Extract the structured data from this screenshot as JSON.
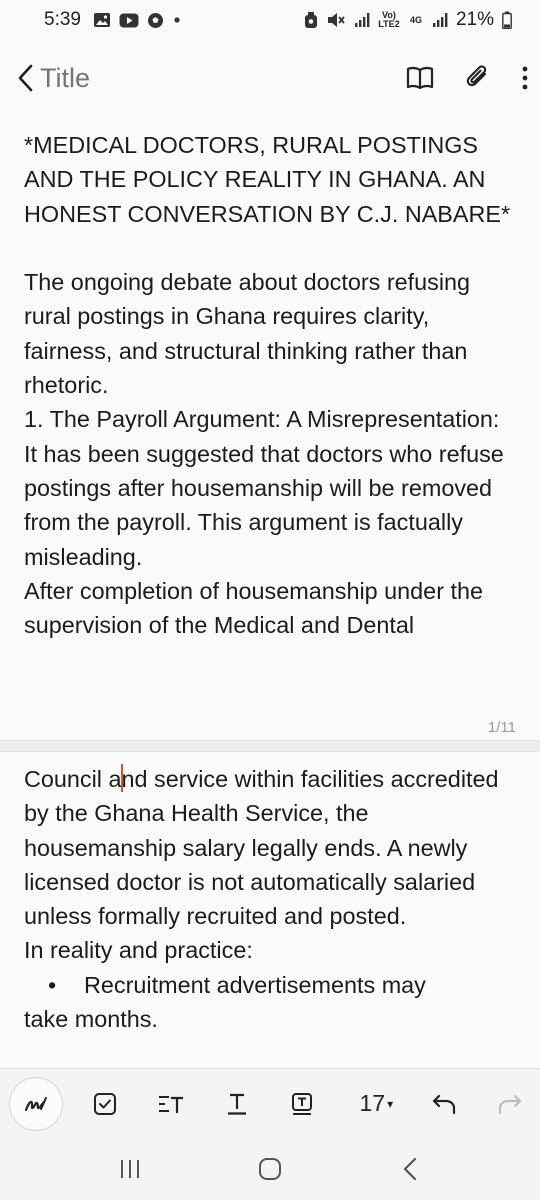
{
  "status_bar": {
    "time": "5:39",
    "left_icons": [
      "gallery-icon",
      "youtube-icon",
      "football-icon",
      "notification-dot-icon"
    ],
    "right_icons": [
      "alarm-icon",
      "mute-icon",
      "signal-icon",
      "volte-icon",
      "4g-icon",
      "signal-icon"
    ],
    "volte_label": "Vo) LTE2",
    "net_label": "4G",
    "battery": "21%"
  },
  "app_bar": {
    "title_placeholder": "Title",
    "actions": [
      "book-icon",
      "attach-icon",
      "more-icon"
    ]
  },
  "page1": {
    "heading": "*MEDICAL DOCTORS, RURAL POSTINGS AND THE POLICY REALITY IN GHANA. AN HONEST CONVERSATION BY C.J. NABARE*",
    "para1": "The ongoing debate about doctors refusing rural postings in Ghana requires clarity, fairness, and structural thinking rather than rhetoric.",
    "section1_title": "1. The Payroll Argument: A Misrepresentation:",
    "para2": "It has been suggested that doctors who refuse postings after housemanship will be removed from the payroll. This argument is factually misleading.",
    "para3": "After completion of housemanship under the supervision of the Medical and Dental",
    "page_number": "1/11"
  },
  "page2": {
    "para1_before_cursor": "Council a",
    "para1_after_cursor": "nd service within facilities accredited by the Ghana Health Service, the housemanship salary legally ends. A newly licensed doctor is not automatically salaried unless formally recruited and posted.",
    "para2": "In reality and practice:",
    "bullet1_line1": "Recruitment advertisements may",
    "bullet1_line2": "take months.",
    "bullet_symbol": "•"
  },
  "toolbar": {
    "font_size": "17",
    "font_size_caret": "▾",
    "items": [
      "handwriting-icon",
      "checkbox-icon",
      "text-format-icon",
      "text-style-icon",
      "text-box-icon",
      "undo-icon",
      "redo-icon"
    ]
  },
  "nav_bar": {
    "items": [
      "recents-icon",
      "home-icon",
      "back-icon"
    ]
  }
}
